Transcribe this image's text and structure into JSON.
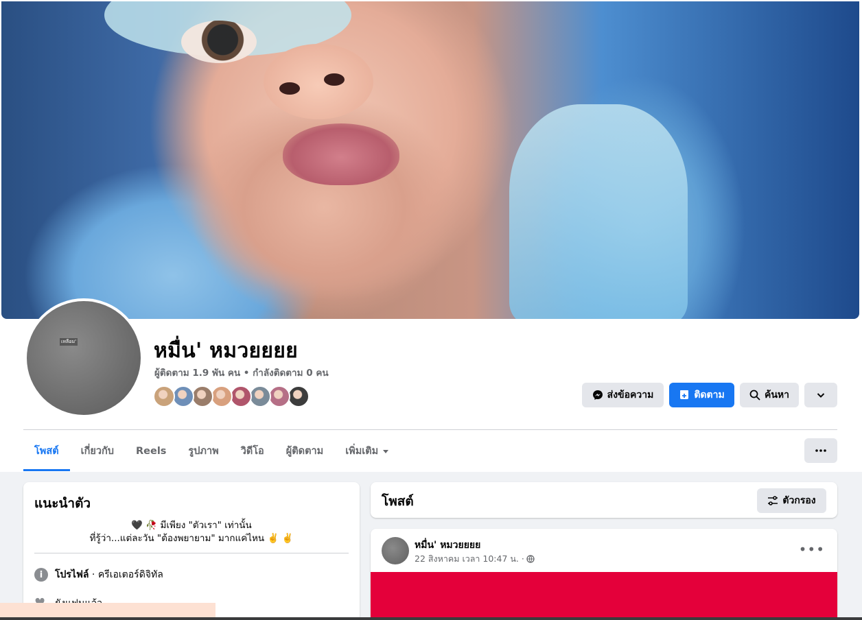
{
  "profile": {
    "name": "หมื่น' หมวยยยย",
    "stats": "ผู้ติดตาม 1.9 พัน คน • กำลังติดตาม 0 คน",
    "avatar_caption": "เหลือม'",
    "friend_colors": [
      "#c9a27a",
      "#6e8fb8",
      "#9a7d6a",
      "#d8a07e",
      "#b0556b",
      "#7a8b99",
      "#b56f86",
      "#3c3c3c"
    ]
  },
  "actions": {
    "message": "ส่งข้อความ",
    "follow": "ติดตาม",
    "search": "ค้นหา"
  },
  "tabs": [
    "โพสต์",
    "เกี่ยวกับ",
    "Reels",
    "รูปภาพ",
    "วิดีโอ",
    "ผู้ติดตาม",
    "เพิ่มเติม"
  ],
  "intro": {
    "title": "แนะนำตัว",
    "bio_line1": "🖤 🥀 มีเพียง \"ตัวเรา\" เท่านั้น",
    "bio_line2": "ที่รู้ว่า...แต่ละวัน \"ต้องพยายาม\" มากแค่ไหน ✌️ ✌️",
    "profile_label": "โปรไฟล์",
    "profile_value": " · ครีเอเตอร์ดิจิทัล",
    "relationship": "ยังแฟนแล้ว"
  },
  "posts": {
    "title": "โพสต์",
    "filter": "ตัวกรอง",
    "author": "หมื่น' หมวยยยย",
    "time": "22 สิงหาคม เวลา 10:47 น. ·"
  },
  "colors": {
    "accent": "#1877f2",
    "media": "#e4003a",
    "feed_bg": "#f0f2f5"
  }
}
